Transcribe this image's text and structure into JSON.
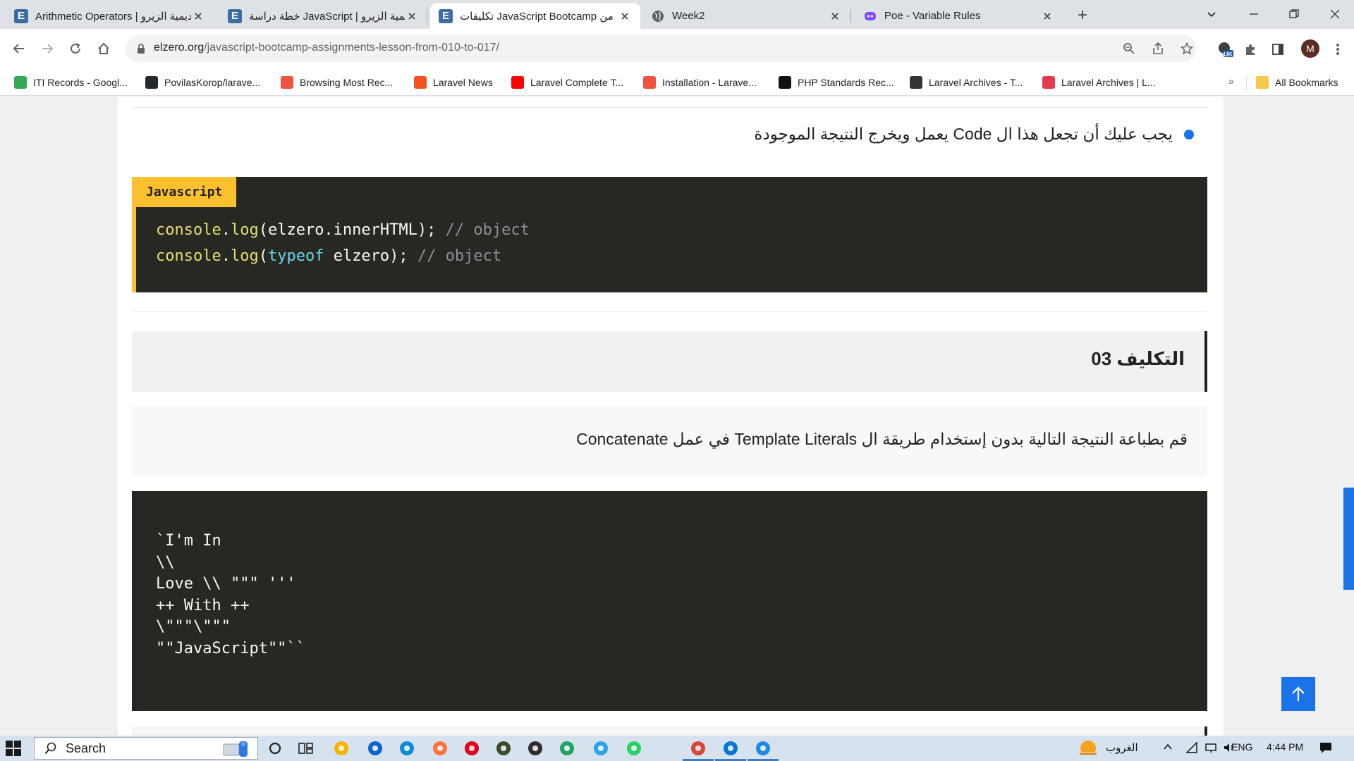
{
  "browser": {
    "tabs": [
      {
        "title": "Arithmetic Operators | أكاديمية الزيرو",
        "favicon": "E",
        "favicon_color": "#3b6ea5",
        "active": false
      },
      {
        "title": "خطة دراسة JavaScript | أكاديمية الزيرو",
        "favicon": "E",
        "favicon_color": "#3b6ea5",
        "active": false
      },
      {
        "title": "تكليفات JavaScript Bootcamp من",
        "favicon": "E",
        "favicon_color": "#3b6ea5",
        "active": true
      },
      {
        "title": "Week2",
        "favicon": "globe",
        "favicon_color": "#5f6368",
        "active": false
      },
      {
        "title": "Poe - Variable Rules",
        "favicon": "poe",
        "favicon_color": "#7c4dff",
        "active": false
      }
    ],
    "new_tab_icon": "plus-icon",
    "window_controls": [
      "tab-search-icon",
      "minimize-icon",
      "restore-icon",
      "close-icon"
    ],
    "url_host": "elzero.org",
    "url_path": "/javascript-bootcamp-assignments-lesson-from-010-to-017/",
    "profile_initial": "M",
    "extension_badge": "UK",
    "bookmarks": [
      {
        "label": "ITI Records - Googl...",
        "icon": "google-drive-icon",
        "color": "#34a853"
      },
      {
        "label": "PovilasKorop/larave...",
        "icon": "github-icon",
        "color": "#24292e"
      },
      {
        "label": "Browsing Most Rec...",
        "icon": "laravel-icon",
        "color": "#f05340"
      },
      {
        "label": "Laravel News",
        "icon": "laravel-news-icon",
        "color": "#f4511e"
      },
      {
        "label": "Laravel Complete T...",
        "icon": "youtube-icon",
        "color": "#ff0000"
      },
      {
        "label": "Installation - Larave...",
        "icon": "laravel-icon",
        "color": "#f05340"
      },
      {
        "label": "PHP Standards Rec...",
        "icon": "php-fig-icon",
        "color": "#111111"
      },
      {
        "label": "Laravel Archives - T...",
        "icon": "tm-icon",
        "color": "#333333"
      },
      {
        "label": "Laravel Archives | L...",
        "icon": "laravel-icon",
        "color": "#e53950"
      }
    ],
    "bookmarks_more": "»",
    "all_bookmarks_label": "All Bookmarks"
  },
  "page": {
    "bullet_text": "يجب عليك أن تجعل هذا ال Code يعمل ويخرج النتيجة الموجودة",
    "code1": {
      "label": "Javascript",
      "lines": [
        [
          {
            "t": "console",
            "c": "fn"
          },
          {
            "t": ".",
            "c": "pl"
          },
          {
            "t": "log",
            "c": "fn"
          },
          {
            "t": "(elzero.innerHTML); ",
            "c": "pl"
          },
          {
            "t": "// object",
            "c": "cm"
          }
        ],
        [
          {
            "t": "console",
            "c": "fn"
          },
          {
            "t": ".",
            "c": "pl"
          },
          {
            "t": "log",
            "c": "fn"
          },
          {
            "t": "(",
            "c": "pl"
          },
          {
            "t": "typeof",
            "c": "kw"
          },
          {
            "t": " elzero); ",
            "c": "pl"
          },
          {
            "t": "// object",
            "c": "cm"
          }
        ]
      ]
    },
    "assignment_heading": "التكليف 03",
    "assignment_text": "قم بطباعة النتيجة التالية بدون إستخدام طريقة ال Template Literals في عمل Concatenate",
    "code2_lines": [
      "`I'm In",
      "\\\\",
      "Love \\\\ \"\"\" '''",
      "++ With ++",
      "\\\"\"\"\\\"\"\"",
      "\"\"JavaScript\"\"``"
    ],
    "back_to_top_icon": "arrow-up-icon"
  },
  "taskbar": {
    "search_placeholder": "Search",
    "apps": [
      {
        "name": "cortana-icon",
        "color": "#222222"
      },
      {
        "name": "task-view-icon",
        "color": "#222222"
      },
      {
        "name": "file-explorer-icon",
        "color": "#f4b400"
      },
      {
        "name": "mail-icon",
        "color": "#0a64c9"
      },
      {
        "name": "edge-icon",
        "color": "#0c8bd6"
      },
      {
        "name": "firefox-icon",
        "color": "#ff7139"
      },
      {
        "name": "opera-icon",
        "color": "#e0001b"
      },
      {
        "name": "app-icon",
        "color": "#3b4b2b"
      },
      {
        "name": "terminal-icon",
        "color": "#2d2d2d"
      },
      {
        "name": "google-drive-icon",
        "color": "#1fa463"
      },
      {
        "name": "telegram-icon",
        "color": "#2aa3df"
      },
      {
        "name": "whatsapp-icon",
        "color": "#25d366"
      },
      {
        "name": "chrome-icon",
        "color": "#db4437"
      },
      {
        "name": "vscode-icon",
        "color": "#0078d4"
      },
      {
        "name": "photos-icon",
        "color": "#1e88e5"
      }
    ],
    "weather_text": "الغروب",
    "language": "ENG",
    "time": "4:44 PM"
  }
}
